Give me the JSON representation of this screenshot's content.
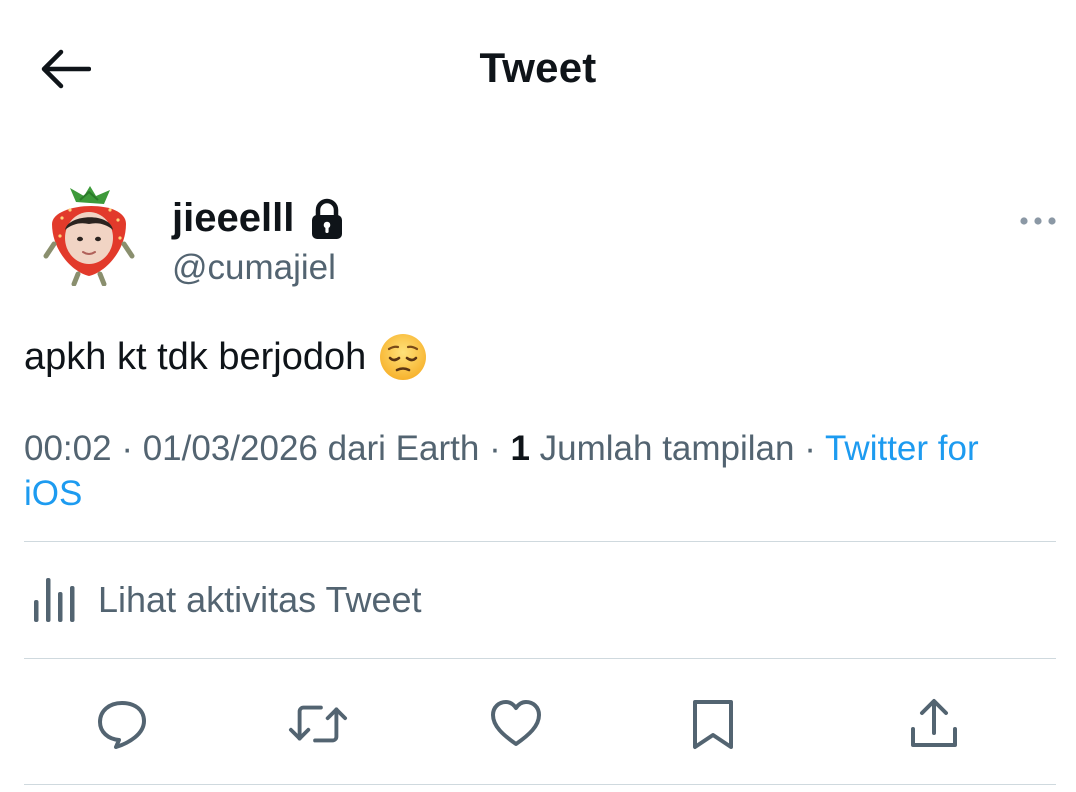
{
  "header": {
    "title": "Tweet",
    "back_icon": "arrow-left-icon"
  },
  "author": {
    "display_name": "jieeelll",
    "handle": "@cumajiel",
    "protected_icon": "lock-icon",
    "avatar": "strawberry-costume-avatar"
  },
  "tweet": {
    "text": "apkh kt tdk berjodoh",
    "emoji": "pensive-face-emoji"
  },
  "meta": {
    "time": "00:02",
    "separator": " · ",
    "date": "01/03/2026",
    "location": " dari Earth",
    "view_count": "1",
    "view_label": " Jumlah tampilan",
    "source": "Twitter for iOS"
  },
  "activity": {
    "label": "Lihat aktivitas Tweet",
    "icon": "bar-chart-icon"
  },
  "actions": [
    "reply-icon",
    "retweet-icon",
    "like-icon",
    "bookmark-icon",
    "share-icon"
  ],
  "colors": {
    "text": "#0f1419",
    "secondary": "#536471",
    "link": "#1d9bf0",
    "divider": "#cfd9de"
  }
}
